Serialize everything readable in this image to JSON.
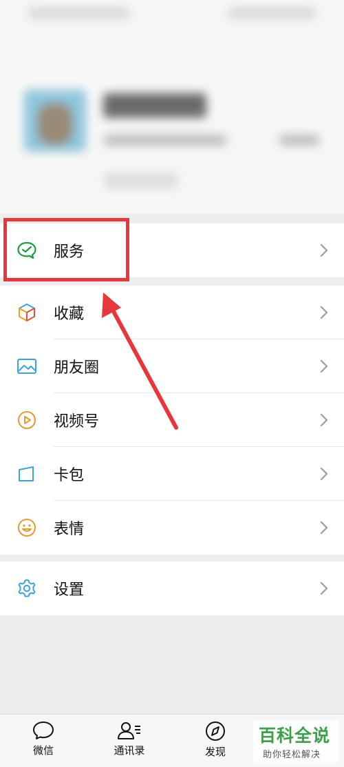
{
  "menu": {
    "service": "服务",
    "favorites": "收藏",
    "moments": "朋友圈",
    "channels": "视频号",
    "cards": "卡包",
    "stickers": "表情",
    "settings": "设置"
  },
  "tabs": {
    "chats": "微信",
    "contacts": "通讯录",
    "discover": "发现"
  },
  "watermark": {
    "title": "百科全说",
    "subtitle": "助你轻松解决"
  },
  "colors": {
    "highlight": "#e8373c",
    "service_icon": "#1a9c3c",
    "watermark_green": "#3aa14a"
  }
}
